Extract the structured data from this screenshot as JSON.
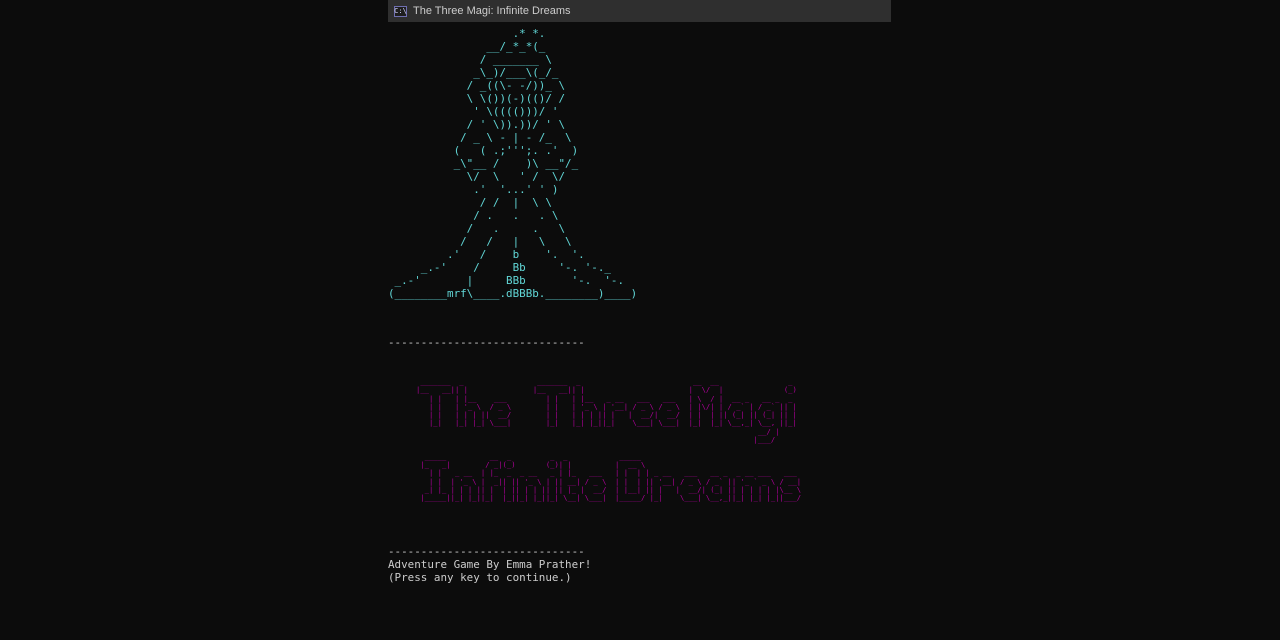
{
  "window": {
    "title": "The Three Magi: Infinite Dreams",
    "icon": "console-icon",
    "icon_glyph": "C:\\"
  },
  "art": {
    "lines": [
      "                   .* *.",
      "               __/_*_*(_",
      "              / _______ \\",
      "             _\\_)/___\\(_/_",
      "            / _((\\- -/))_ \\",
      "            \\ \\())(-)(()/ /",
      "             ' \\(((()))/ '",
      "            / ' \\)).))/ ' \\",
      "           / _ \\ - | - /_  \\",
      "          (   ( .;''';. .'  )",
      "          _\\\"__ /    )\\ __\"/_",
      "            \\/  \\   ' /  \\/",
      "             .'  '...' ' )",
      "              / /  |  \\ \\",
      "             / .   .   . \\",
      "            /   .     .   \\",
      "           /   /   |   \\   \\",
      "         .'   /    b    '.  '.",
      "     _.-'    /     Bb     '-. '-._",
      " _.-'       |     BBb       '-.  '-.",
      "(________mrf\\____.dBBBb.________)____)"
    ]
  },
  "rule": "------------------------------",
  "banner": {
    "lines": [
      " _______  _                 _______  _                          __  __                _ ",
      "|__   __|| |               |__   __|| |                        |  \\/  |              (_)",
      "   | |   | |__    ___         | |   | |__   _ __   ___   ___   | \\  / |  __ _   __ _  _ ",
      "   | |   | '_ \\  / _ \\        | |   | '_ \\ | '__| / _ \\ / _ \\  | |\\/| | / _` | / _` || |",
      "   | |   | | | ||  __/        | |   | | | || |   |  __/|  __/  | |  | || (_| || (_| || |",
      "   |_|   |_| |_| \\___|        |_|   |_| |_||_|    \\___| \\___|  |_|  |_| \\__,_| \\__, ||_|",
      "                                                                               __/ |   ",
      "                                                                              |___/    ",
      "",
      "  _____          __  _         _  _            _____                                   ",
      " |_   _|        / _|(_)       (_)| |          |  __ \\                                  ",
      "   | |   _ __  | |_  _  _ __   _ | |_   ___   | |  | | _ __   ___   __ _  _ __ ___   ___ ",
      "   | |  | '_ \\ |  _|| || '_ \\ | || __| / _ \\  | |  | || '__| / _ \\ / _` || '_ ` _ \\ / __|",
      "  _| |_ | | | || |  | || | | || || |_ |  __/  | |__| || |   |  __/| (_| || | | | | |\\__ \\",
      " |_____||_| |_||_|  |_||_| |_||_| \\__| \\___|  |_____/ |_|    \\___| \\__,_||_| |_| |_||___/"
    ]
  },
  "footer": {
    "credit": "Adventure Game By Emma Prather!",
    "prompt": "(Press any key to continue.)"
  },
  "colors": {
    "background": "#0c0c0c",
    "titlebar": "#2f2f2f",
    "art": "#61d6d6",
    "banner": "#b4009e",
    "text": "#cccccc"
  }
}
